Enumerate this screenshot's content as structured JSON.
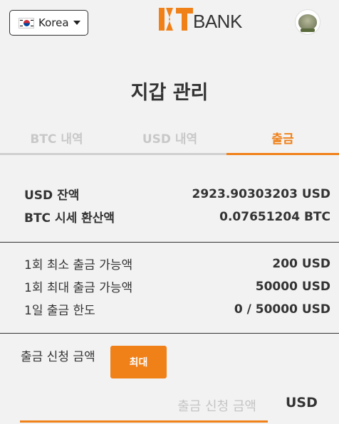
{
  "header": {
    "language_label": "Korea",
    "logo_text": "BANK",
    "brand_color": "#f08018"
  },
  "page": {
    "title": "지갑 관리"
  },
  "tabs": [
    {
      "label": "BTC 내역",
      "active": false
    },
    {
      "label": "USD 내역",
      "active": false
    },
    {
      "label": "출금",
      "active": true
    }
  ],
  "balances": {
    "usd_label": "USD 잔액",
    "usd_value": "2923.90303203 USD",
    "btc_label": "BTC 시세 환산액",
    "btc_value": "0.07651204 BTC"
  },
  "limits": {
    "min_label": "1회 최소 출금 가능액",
    "min_value": "200 USD",
    "max_label": "1회 최대 출금 가능액",
    "max_value": "50000 USD",
    "daily_label": "1일 출금 한도",
    "daily_value": "0 / 50000 USD"
  },
  "request": {
    "label": "출금 신청 금액",
    "max_button": "최대",
    "placeholder": "출금 신청 금액",
    "unit": "USD"
  },
  "icons": {
    "flag": "korea-flag-icon",
    "caret": "caret-down-icon",
    "avatar": "user-avatar-icon"
  }
}
